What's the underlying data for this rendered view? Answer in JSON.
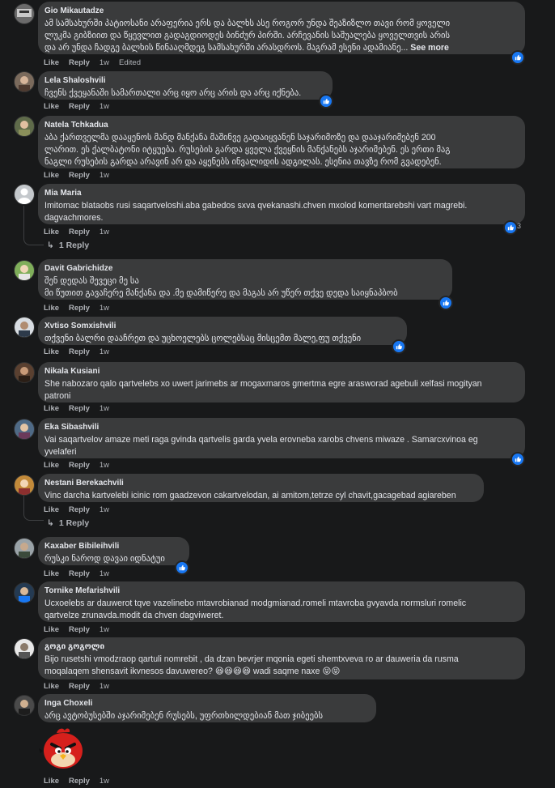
{
  "actions": {
    "like": "Like",
    "reply": "Reply",
    "edited": "Edited"
  },
  "comments": [
    {
      "name": "Gio Mikautadze",
      "time": "1w",
      "lines": [
        "ამ სამსახურში პატიოსანი არაფერია ერს და ბალხს ასე როგორ უნდა შეაზიზლო თავი რომ ყოველი",
        "ლუკმა გიბზიით და წყევლით გადაგდიოდეს ბინძურ პირში. არჩევანის საშუალება ყოველთვის არის",
        "და არ უნდა ჩადგე ბალხის წინააღმდეგ სამსახურში არასდროს. მაგრამ ესენი ადამიანე..."
      ],
      "see_more": "See more"
    },
    {
      "name": "Lela Shaloshvili",
      "time": "1w",
      "lines": [
        "ჩვენს ქვეყანაში სამართალი არც იყო არც არის და არც იქნება."
      ]
    },
    {
      "name": "Natela Tchkadua",
      "time": "1w",
      "lines": [
        "აბა ქართველმა დააყენოს მანდ მანქანა მაშინვე გადაიყვანენ საჯარიმოზე და დააჯარიმებენ 200",
        "ლარით. ეს ქალბატონი იტყუება. რუსების გარდა ყველა ქვეყნის მანქანებს აჯარიმებენ. ეს ერთი მაგ",
        "ნაგლი რუსების გარდა არავინ არ და აყენებს ინვალიდის ადგილას. ესენია თავზე რომ გვადებენ."
      ]
    },
    {
      "name": "Mia Maria",
      "time": "1w",
      "reaction_count": "3",
      "reply_text": "1 Reply",
      "lines": [
        "Imitomac blataobs rusi saqartveloshi.aba gabedos sxva qvekanashi.chven mxolod komentarebshi vart magrebi.",
        "dagvachmores."
      ]
    },
    {
      "name": "Davit Gabrichidze",
      "time": "1w",
      "lines": [
        "შენ დედას შევეცი მე სა",
        "მი წუთით გავაჩერე მანქანა და .მე დამიწერე და მაგას არ უწერ თქვე დედა საიყნაპბობ"
      ]
    },
    {
      "name": "Xvtiso Somxishvili",
      "time": "1w",
      "lines": [
        "თქვენი ბალრი დააჩრეთ და უცხოელებს ცოლებსაც მისცემთ მალე,ფუ თქვენი"
      ]
    },
    {
      "name": "Nikala Kusiani",
      "time": "1w",
      "lines": [
        "She nabozaro qalo qartvelebs xo uwert jarimebs ar mogaxmaros gmertma egre araswor͏ad agebuli xelfasi mogityan",
        "patroni"
      ]
    },
    {
      "name": "Eka Sibashvili",
      "time": "1w",
      "lines": [
        "Vai saqartvelov amaze meti raga gvinda qartvelis garda yvela erovneba xarobs chvens miwaze . Samarcxvinoa eg",
        "yvelaferi"
      ]
    },
    {
      "name": "Nestani Berekachvili",
      "time": "1w",
      "reply_text": "1 Reply",
      "lines": [
        "Vinc darcha kartvelebi icinic rom gaadzevon cakartvelodan, ai amitom,tetrze cyl chavit,gacagebad agiareben"
      ]
    },
    {
      "name": "Kaxaber Bibileihvili",
      "time": "1w",
      "lines": [
        "რუსკი ნაროდ დავაი იდნატუი"
      ]
    },
    {
      "name": "Tornike Mefarishvili",
      "time": "1w",
      "lines": [
        "Ucxoelebs ar dauwerot tqve vazelinebo mtavrobianad modgmianad.romeli mtavroba gvyavda normsluri romelic",
        "qartvelze zrunavda.modit da chven dagviweret."
      ]
    },
    {
      "name": "გოგი გოგოლი",
      "time": "1w",
      "lines": [
        "Bijo rusetshi vmodzraop qartuli nomrebit , da dzan bevrjer mqonia egeti shemtxveva ro ar dauweria da rusma",
        "moqalaqem shensavit ikvnesos davuwereo? 😆😆😆😆 wadi saqme naxe 😝😝"
      ]
    },
    {
      "name": "Inga Choxeli",
      "time": "1w",
      "lines": [
        "არც ავტობუსებში აჯარიმებენ რუსებს, უფრთხილდებიან მათ ჯიბეებს"
      ]
    }
  ],
  "colors": {
    "background": "#18191a",
    "bubble": "#3a3b3c",
    "like_blue": "#1877f2",
    "muted": "#b0b3b8"
  },
  "icons": {
    "reaction": "thumbs-up-icon",
    "reply_arrow": "reply-arrow-icon",
    "sticker": "angry-bird-sticker"
  }
}
